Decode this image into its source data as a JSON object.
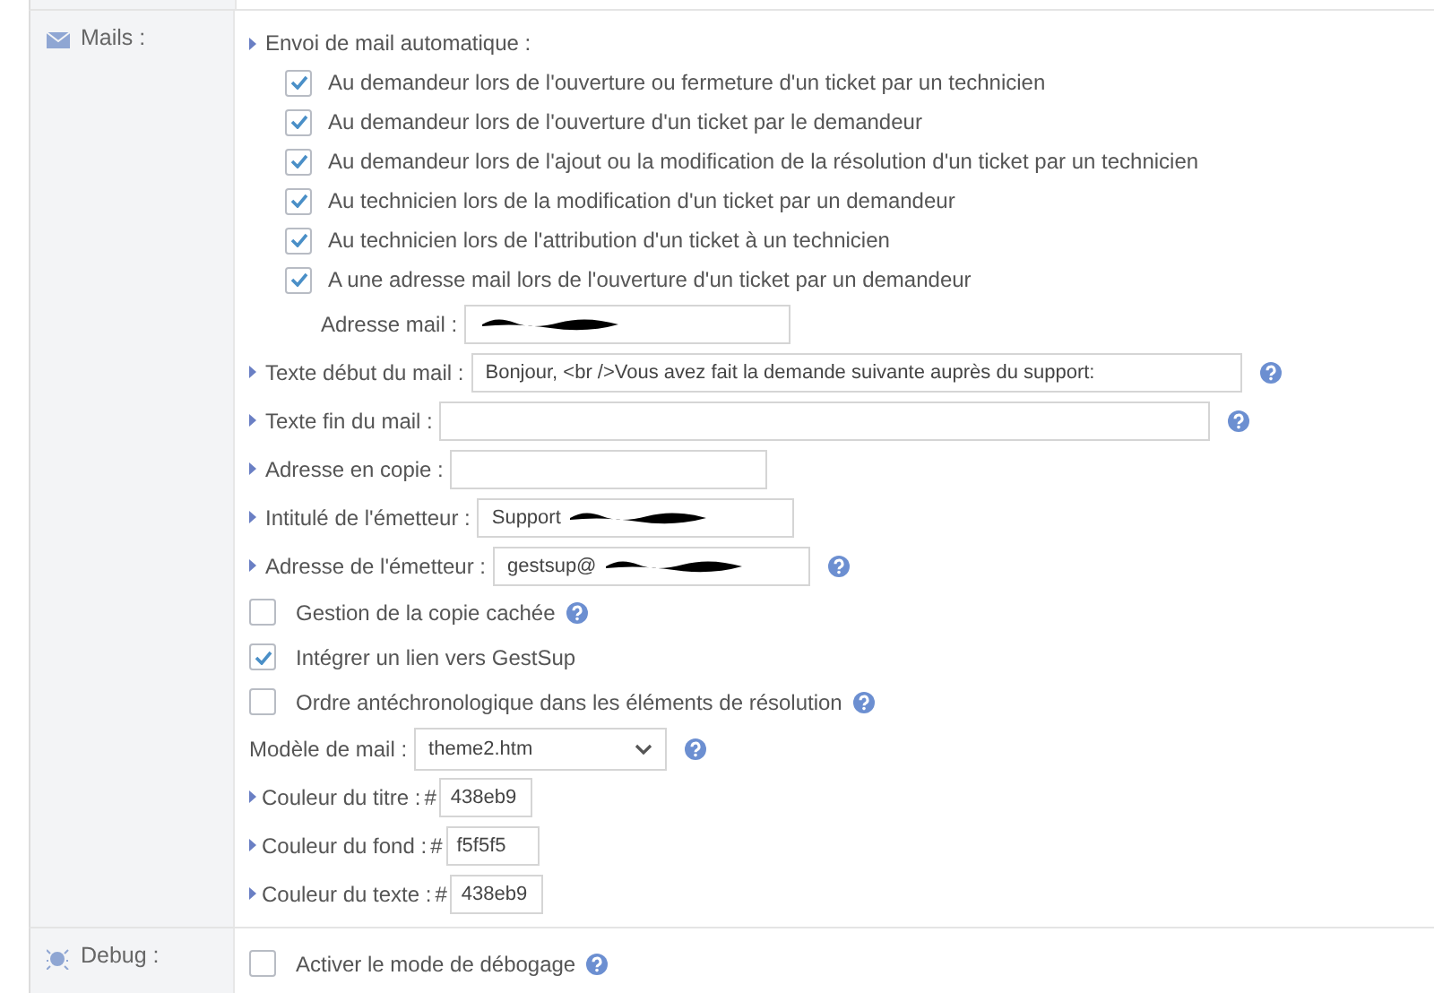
{
  "sections": [
    {
      "label": "Mails :",
      "items": [
        {
          "kind": "group",
          "label": "Envoi de mail automatique :",
          "options": [
            {
              "label": "Au demandeur lors de l'ouverture ou fermeture d'un ticket par un technicien",
              "checked": true
            },
            {
              "label": "Au demandeur lors de l'ouverture d'un ticket par le demandeur",
              "checked": true
            },
            {
              "label": "Au demandeur lors de l'ajout ou la modification de la résolution d'un ticket par un technicien",
              "checked": true
            },
            {
              "label": "Au technicien lors de la modification d'un ticket par un demandeur",
              "checked": true
            },
            {
              "label": "Au technicien lors de l'attribution d'un ticket à un technicien",
              "checked": true
            },
            {
              "label": "A une adresse mail lors de l'ouverture d'un ticket par un demandeur",
              "checked": true
            }
          ],
          "sub_field": {
            "label": "Adresse mail :",
            "redacted": true
          }
        },
        {
          "kind": "long_field",
          "label": "Texte début du mail :",
          "value": "Bonjour, <br />Vous avez fait la demande suivante auprès du support:",
          "help": true
        },
        {
          "kind": "long_field",
          "label": "Texte fin du mail :",
          "help": true
        },
        {
          "kind": "field",
          "label": "Adresse en copie :"
        },
        {
          "kind": "field",
          "label": "Intitulé de l'émetteur :",
          "value": "Support",
          "redacted": true
        },
        {
          "kind": "field",
          "label": "Adresse de l'émetteur :",
          "value": "gestsup@",
          "redacted": true,
          "help": true
        },
        {
          "kind": "check",
          "label": "Gestion de la copie cachée",
          "checked": false,
          "help": true
        },
        {
          "kind": "check",
          "label": "Intégrer un lien vers GestSup",
          "checked": true
        },
        {
          "kind": "check",
          "label": "Ordre antéchronologique dans les éléments de résolution",
          "checked": false,
          "help": true
        },
        {
          "kind": "select",
          "label": "Modèle de mail :",
          "value": "theme2.htm",
          "help": true
        },
        {
          "kind": "color",
          "label": "Couleur du titre :",
          "hash": "#",
          "value": "438eb9"
        },
        {
          "kind": "color",
          "label": "Couleur du fond :",
          "hash": "#",
          "value": "f5f5f5"
        },
        {
          "kind": "color",
          "label": "Couleur du texte :",
          "hash": "#",
          "value": "438eb9"
        }
      ]
    },
    {
      "label": "Debug :",
      "items": [
        {
          "kind": "check",
          "label": "Activer le mode de débogage",
          "checked": false,
          "help": true
        }
      ]
    }
  ]
}
